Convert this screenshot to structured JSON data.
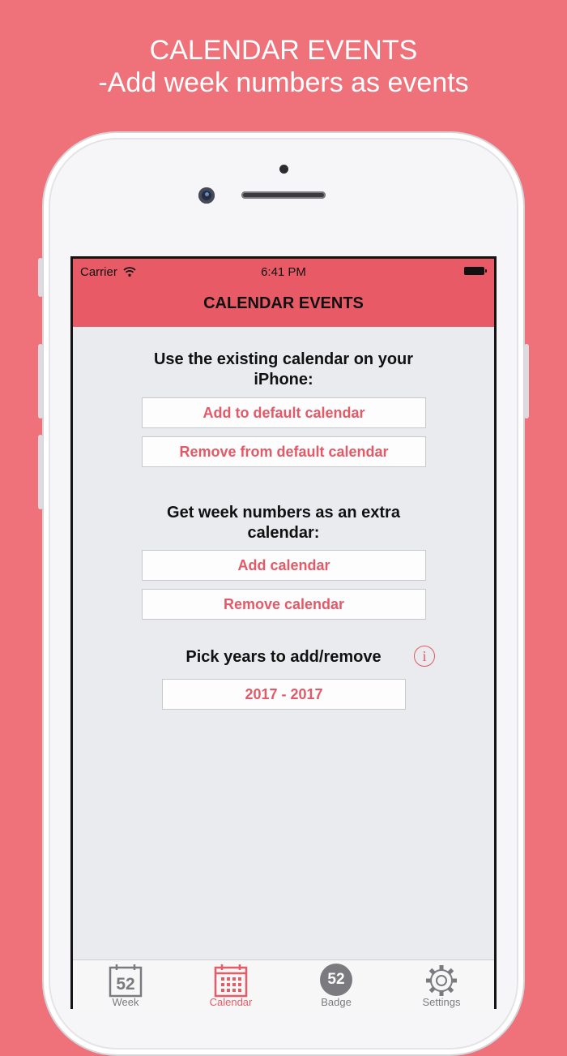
{
  "promo": {
    "title_line1": "CALENDAR EVENTS",
    "title_line2": "-Add week numbers as events"
  },
  "status_bar": {
    "carrier": "Carrier",
    "time": "6:41 PM"
  },
  "nav": {
    "title": "CALENDAR EVENTS"
  },
  "existing_section": {
    "title_line1": "Use the existing calendar on your",
    "title_line2": "iPhone:",
    "add_button": "Add to default calendar",
    "remove_button": "Remove from default calendar"
  },
  "extra_section": {
    "title_line1": "Get week numbers as an extra",
    "title_line2": "calendar:",
    "add_button": "Add calendar",
    "remove_button": "Remove calendar"
  },
  "years_section": {
    "title": "Pick years to add/remove",
    "info_glyph": "i",
    "range_button": "2017 - 2017"
  },
  "tabbar": {
    "tabs": [
      {
        "label": "Week",
        "icon": "calendar-52-icon",
        "icon_text": "52",
        "active": false
      },
      {
        "label": "Calendar",
        "icon": "calendar-grid-icon",
        "active": true
      },
      {
        "label": "Badge",
        "icon": "badge-52-icon",
        "icon_text": "52",
        "active": false
      },
      {
        "label": "Settings",
        "icon": "gear-icon",
        "active": false
      }
    ]
  },
  "colors": {
    "background": "#ef717a",
    "navbar": "#e95a67",
    "accent": "#e45968",
    "tab_inactive": "#7b7b7f"
  }
}
